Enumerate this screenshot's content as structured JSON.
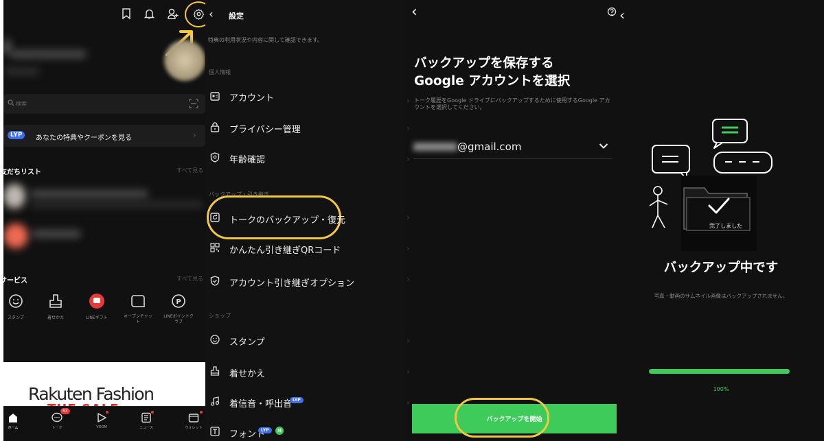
{
  "home": {
    "search_placeholder": "検索",
    "lyp_badge": "LYP",
    "lyp_banner": "あなたの特典やクーポンを見る",
    "friends_title": "友だちリスト",
    "friends_more": "すべて見る",
    "services_title": "サービス",
    "services_more": "すべて見る",
    "services": [
      {
        "label": "スタンプ",
        "icon": "smiley-icon"
      },
      {
        "label": "着せかえ",
        "icon": "brush-icon"
      },
      {
        "label": "LINEギフト",
        "icon": "gift-icon"
      },
      {
        "label": "オープンチャット",
        "icon": "chat-bubble-icon"
      },
      {
        "label": "LINEポイントクラブ",
        "icon": "points-icon"
      }
    ],
    "ad_text": "Rakuten Fashion",
    "ad_subtext": "THE SALE",
    "nav": [
      {
        "label": "ホーム",
        "icon": "home-icon"
      },
      {
        "label": "トーク",
        "icon": "talk-icon",
        "badge": "63"
      },
      {
        "label": "VOOM",
        "icon": "voom-icon"
      },
      {
        "label": "ニュース",
        "icon": "news-icon"
      },
      {
        "label": "ウォレット",
        "icon": "wallet-icon"
      }
    ],
    "accent": "#f5c842"
  },
  "settings": {
    "title": "設定",
    "subtitle": "特典の利用状況や内容に関して確認できます。",
    "section_personal": "個人情報",
    "section_backup": "バックアップ・引き継ぎ",
    "section_shop": "ショップ",
    "items": [
      {
        "label": "アカウント",
        "icon": "id-card-icon"
      },
      {
        "label": "プライバシー管理",
        "icon": "lock-icon"
      },
      {
        "label": "年齢確認",
        "icon": "age-shield-icon"
      },
      {
        "label": "トークのバックアップ・復元",
        "icon": "backup-icon"
      },
      {
        "label": "かんたん引き継ぎQRコード",
        "icon": "qr-icon"
      },
      {
        "label": "アカウント引き継ぎオプション",
        "icon": "shield-check-icon"
      },
      {
        "label": "スタンプ",
        "icon": "smiley-icon"
      },
      {
        "label": "着せかえ",
        "icon": "brush-icon"
      },
      {
        "label": "着信音・呼出音",
        "icon": "music-icon",
        "badge": "LYP"
      },
      {
        "label": "フォント",
        "icon": "font-icon",
        "badge": "LYP",
        "badge2": "N"
      }
    ]
  },
  "backup": {
    "title_line1": "バックアップを保存する",
    "title_line2": "Google アカウントを選択",
    "description": "トーク履歴をGoogle ドライブにバックアップするために使用するGoogle アカウントを選択してください。",
    "account": "@gmail.com",
    "start_button": "バックアップを開始",
    "button_color": "#3fcb5a"
  },
  "progress": {
    "done_label": "完了しました",
    "title": "バックアップ中です",
    "note": "写真・動画のサムネイル画像はバックアップされません。",
    "percent_label": "100%",
    "progress": 1.0,
    "bar_color": "#3fcb5a"
  }
}
